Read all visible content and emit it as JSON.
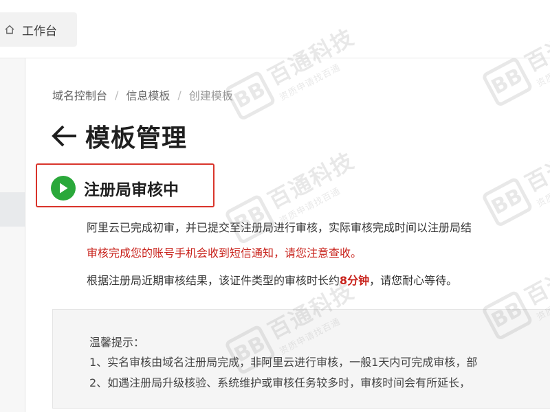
{
  "topbar": {
    "workbench_label": "工作台",
    "home_icon": "home-icon"
  },
  "breadcrumb": {
    "items": [
      "域名控制台",
      "信息模板",
      "创建模板"
    ],
    "separator": "/"
  },
  "page": {
    "title": "模板管理",
    "back_icon": "arrow-left-icon"
  },
  "status": {
    "title": "注册局审核中",
    "icon": "play-circle-icon",
    "icon_color": "#2aa83a",
    "box_color": "#d9342b"
  },
  "info": {
    "line1": "阿里云已完成初审，并已提交至注册局进行审核，实际审核完成时间以注册局结",
    "line2": "审核完成您的账号手机会收到短信通知，请您注意查收。",
    "line3_prefix": "根据注册局近期审核结果，该证件类型的审核时长约",
    "line3_highlight": "8分钟",
    "line3_suffix": "，请您耐心等待。",
    "alert_color": "#c8211a"
  },
  "tips": {
    "title": "温馨提示：",
    "items": [
      "1、实名审核由域名注册局完成，非阿里云进行审核，一般1天内可完成审核，部",
      "2、如遇注册局升级核验、系统维护或审核任务较多时，审核时间会有所延长，"
    ]
  },
  "watermark": {
    "logo": "BB",
    "name": "百通科技",
    "slogan": "资质申请找百通"
  }
}
